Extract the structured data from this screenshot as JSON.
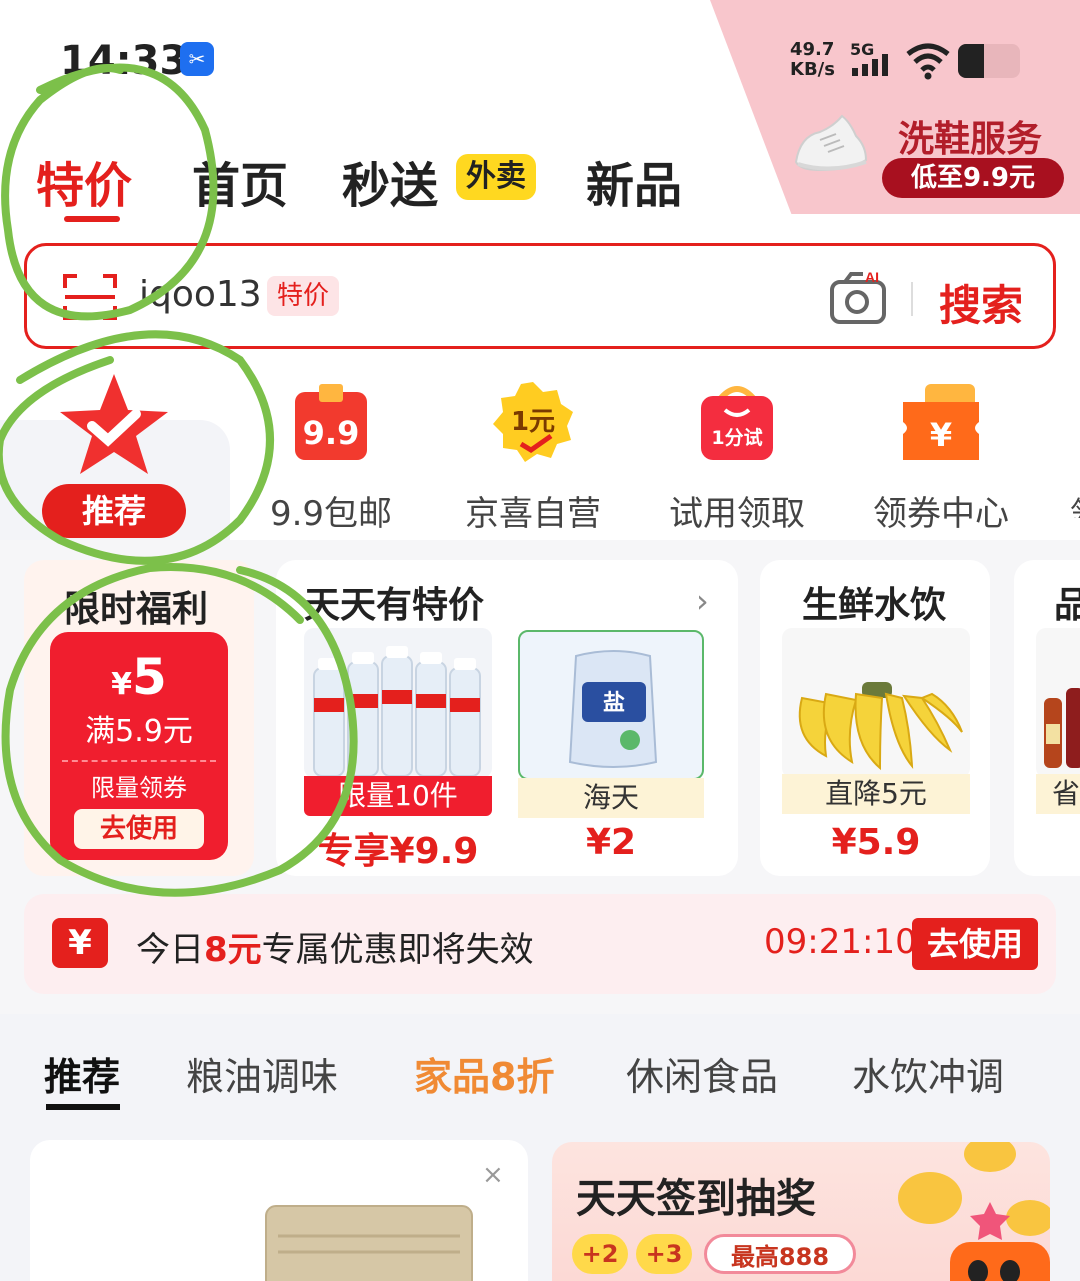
{
  "status_bar": {
    "time": "14:33",
    "net_speed_value": "49.7",
    "net_speed_unit": "KB/s",
    "network": "5G"
  },
  "corner_promo": {
    "title": "洗鞋服务",
    "subtitle": "低至9.9元"
  },
  "top_tabs": [
    {
      "label": "特价",
      "active": true
    },
    {
      "label": "首页"
    },
    {
      "label": "秒送"
    },
    {
      "label": "新品"
    }
  ],
  "waimai_badge": "外卖",
  "search": {
    "query": "iqoo13",
    "tag": "特价",
    "button": "搜索",
    "ai_label": "AI"
  },
  "categories": [
    {
      "label": "推荐",
      "icon": "star-check-icon"
    },
    {
      "label": "9.9包邮",
      "icon": "bag-99-icon",
      "badge": "9.9"
    },
    {
      "label": "京喜自营",
      "icon": "one-yuan-icon",
      "badge": "1元"
    },
    {
      "label": "试用领取",
      "icon": "trial-bag-icon",
      "badge": "1分试"
    },
    {
      "label": "领券中心",
      "icon": "coupon-center-icon",
      "badge": "¥"
    }
  ],
  "welfare": {
    "title": "限时福利",
    "currency": "¥",
    "amount": "5",
    "condition": "满5.9元",
    "limit_text": "限量领券",
    "use_button": "去使用"
  },
  "daily_deals": {
    "title": "天天有特价",
    "products": [
      {
        "tag": "限量10件",
        "price": "专享¥9.9"
      },
      {
        "tag": "海天",
        "price": "¥2"
      }
    ]
  },
  "fresh": {
    "title": "生鲜水饮",
    "products": [
      {
        "tag": "直降5元",
        "price": "¥5.9"
      }
    ]
  },
  "fourth_card": {
    "title": "品",
    "tag": "省"
  },
  "notice": {
    "icon": "¥",
    "text_before": "今日",
    "highlight": "8元",
    "text_after": "专属优惠即将失效",
    "timer": "09:21:10",
    "button": "去使用"
  },
  "bottom_tabs": [
    {
      "label": "推荐",
      "active": true
    },
    {
      "label": "粮油调味"
    },
    {
      "label": "家品8折",
      "highlight": true
    },
    {
      "label": "休闲食品"
    },
    {
      "label": "水饮冲调"
    }
  ],
  "feed": {
    "close": "×",
    "right_title": "天天签到抽奖",
    "chips": [
      "+2",
      "+3",
      "最高888"
    ]
  },
  "colors": {
    "brand_red": "#e4201d",
    "annotation_green": "#7cc04a",
    "promo_pink": "#f8c6cc",
    "highlight_orange": "#f08a34"
  }
}
